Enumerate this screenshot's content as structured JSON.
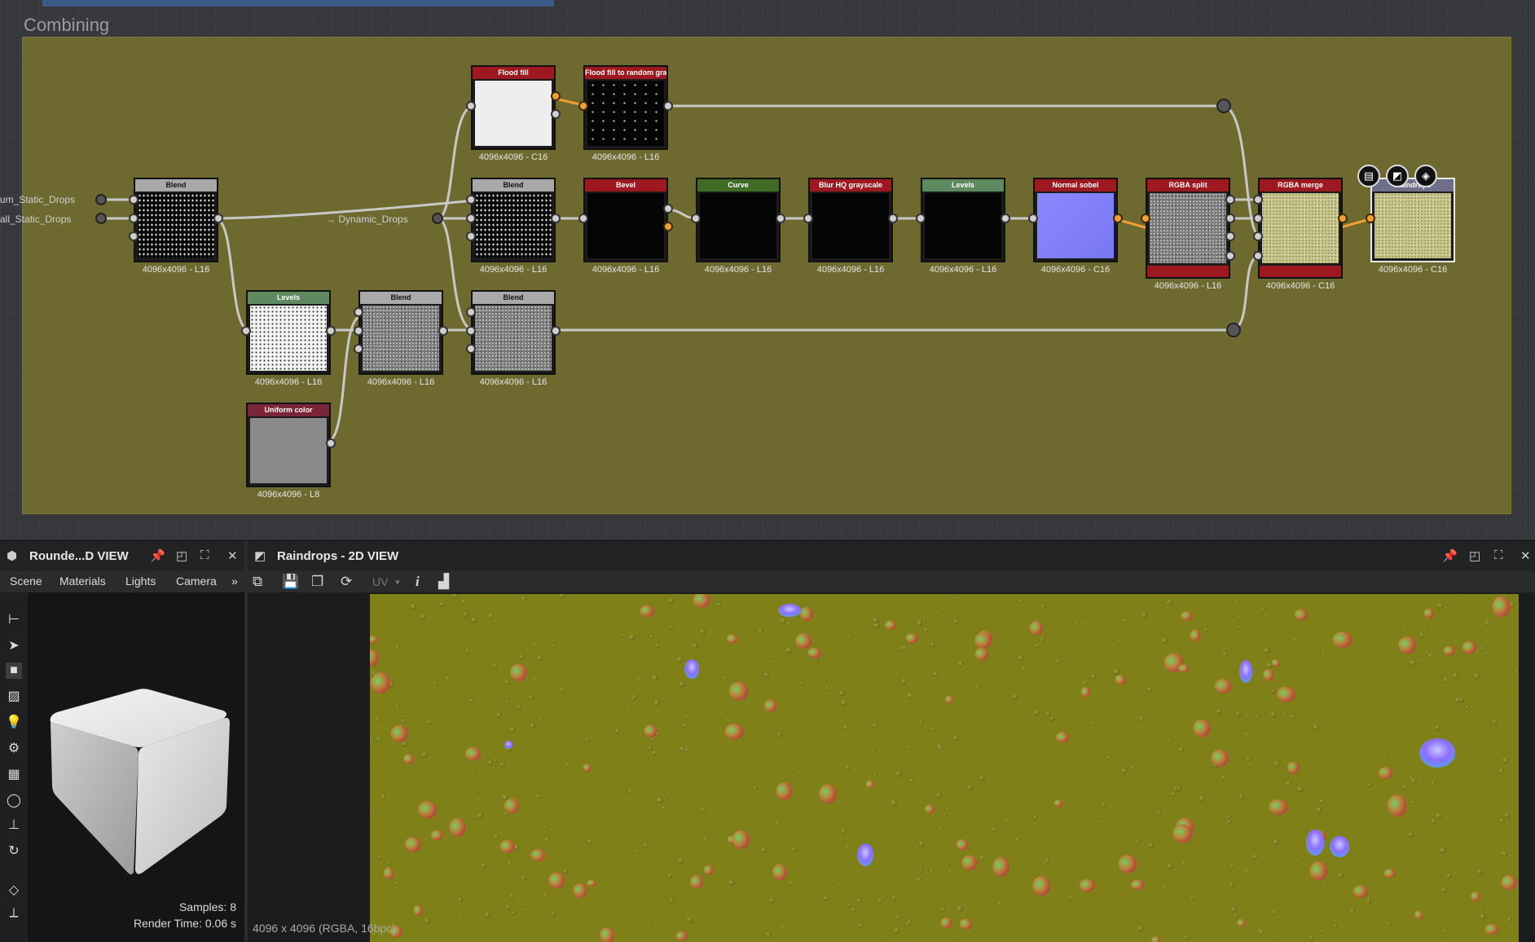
{
  "graph": {
    "frame_title": "Combining",
    "inputs": [
      {
        "label": "um_Static_Drops"
      },
      {
        "label": "all_Static_Drops"
      },
      {
        "label": "→ Dynamic_Drops"
      }
    ],
    "nodes": [
      {
        "id": "blend1",
        "title": "Blend",
        "caption": "4096x4096 - L16",
        "hdr": "#a9a9a9",
        "hdr_text": "#111",
        "thumb": "noise-dark"
      },
      {
        "id": "flood",
        "title": "Flood fill",
        "caption": "4096x4096 - C16",
        "hdr": "#9e1820",
        "hdr_text": "#fff",
        "thumb": "white"
      },
      {
        "id": "floodrand",
        "title": "Flood fill to random gra...",
        "caption": "4096x4096 - L16",
        "hdr": "#9e1820",
        "hdr_text": "#fff",
        "thumb": "stars"
      },
      {
        "id": "blend2",
        "title": "Blend",
        "caption": "4096x4096 - L16",
        "hdr": "#a9a9a9",
        "hdr_text": "#111",
        "thumb": "noise-dark"
      },
      {
        "id": "bevel",
        "title": "Bevel",
        "caption": "4096x4096 - L16",
        "hdr": "#9e1820",
        "hdr_text": "#fff",
        "thumb": "black"
      },
      {
        "id": "curve",
        "title": "Curve",
        "caption": "4096x4096 - L16",
        "hdr": "#3f6b24",
        "hdr_text": "#fff",
        "thumb": "black"
      },
      {
        "id": "blurhq",
        "title": "Blur HQ grayscale",
        "caption": "4096x4096 - L16",
        "hdr": "#9e1820",
        "hdr_text": "#fff",
        "thumb": "black"
      },
      {
        "id": "levels2",
        "title": "Levels",
        "caption": "4096x4096 - L16",
        "hdr": "#5f8a5f",
        "hdr_text": "#fff",
        "thumb": "black"
      },
      {
        "id": "sobel",
        "title": "Normal sobel",
        "caption": "4096x4096 - C16",
        "hdr": "#9e1820",
        "hdr_text": "#fff",
        "thumb": "normal"
      },
      {
        "id": "split",
        "title": "RGBA split",
        "caption": "4096x4096 - L16",
        "hdr": "#9e1820",
        "hdr_text": "#fff",
        "thumb": "gray-noise"
      },
      {
        "id": "merge",
        "title": "RGBA merge",
        "caption": "4096x4096 - C16",
        "hdr": "#9e1820",
        "hdr_text": "#fff",
        "thumb": "yellow-noise"
      },
      {
        "id": "output",
        "title": "Raindrops",
        "caption": "4096x4096 - C16",
        "hdr": "#6f6f8a",
        "hdr_text": "#fff",
        "thumb": "yellow-noise"
      },
      {
        "id": "levels1",
        "title": "Levels",
        "caption": "4096x4096 - L16",
        "hdr": "#5f8a5f",
        "hdr_text": "#fff",
        "thumb": "white-noise"
      },
      {
        "id": "blend3",
        "title": "Blend",
        "caption": "4096x4096 - L16",
        "hdr": "#a9a9a9",
        "hdr_text": "#111",
        "thumb": "gray-noise"
      },
      {
        "id": "blend4",
        "title": "Blend",
        "caption": "4096x4096 - L16",
        "hdr": "#a9a9a9",
        "hdr_text": "#111",
        "thumb": "gray-noise"
      },
      {
        "id": "uniform",
        "title": "Uniform color",
        "caption": "4096x4096 - L8",
        "hdr": "#7a2638",
        "hdr_text": "#fff",
        "thumb": "gray"
      }
    ],
    "output_toolbar_icons": [
      "document-icon",
      "2d-view-icon",
      "3d-view-icon"
    ]
  },
  "panel3d": {
    "title": "Rounde...D VIEW",
    "menu": [
      "Scene",
      "Materials",
      "Lights",
      "Camera"
    ],
    "more": "»",
    "samples": "Samples: 8",
    "render_time": "Render Time: 0.06 s"
  },
  "panel2d": {
    "title": "Raindrops - 2D VIEW",
    "uv_label": "UV",
    "info_label": "i",
    "image_info": "4096 x 4096 (RGBA, 16bpc)"
  },
  "colors": {
    "frame": "#6e6a2f",
    "texture_base": "#7f8017",
    "accent_wire": "#f0a030"
  }
}
